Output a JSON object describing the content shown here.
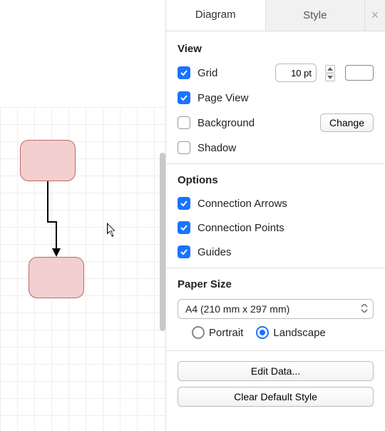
{
  "tabs": {
    "diagram": "Diagram",
    "style": "Style"
  },
  "view": {
    "title": "View",
    "grid": {
      "label": "Grid",
      "checked": true,
      "value": "10 pt"
    },
    "pageView": {
      "label": "Page View",
      "checked": true
    },
    "background": {
      "label": "Background",
      "checked": false,
      "button": "Change"
    },
    "shadow": {
      "label": "Shadow",
      "checked": false
    },
    "swatchColor": "#ffffff"
  },
  "options": {
    "title": "Options",
    "connectionArrows": {
      "label": "Connection Arrows",
      "checked": true
    },
    "connectionPoints": {
      "label": "Connection Points",
      "checked": true
    },
    "guides": {
      "label": "Guides",
      "checked": true
    }
  },
  "paperSize": {
    "title": "Paper Size",
    "selected": "A4 (210 mm x 297 mm)",
    "orientation": {
      "portrait": "Portrait",
      "landscape": "Landscape",
      "selected": "landscape"
    }
  },
  "footer": {
    "editData": "Edit Data...",
    "clearDefault": "Clear Default Style"
  }
}
